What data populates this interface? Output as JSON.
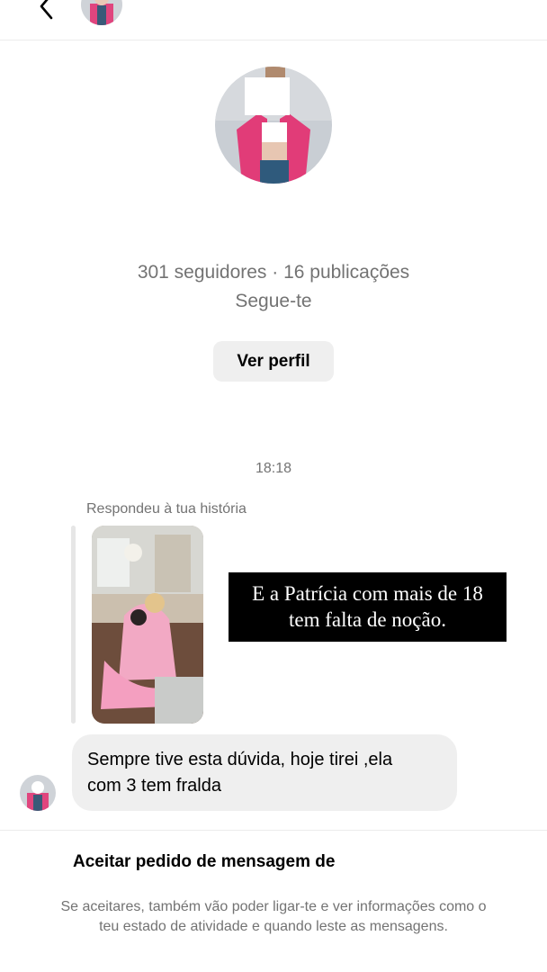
{
  "profile": {
    "stats": "301 seguidores · 16 publicações",
    "follow_status": "Segue-te",
    "view_profile_label": "Ver perfil"
  },
  "thread": {
    "timestamp": "18:18",
    "replied_label": "Respondeu à tua história",
    "story_caption": {
      "line1": "E a Patrícia com mais de 18",
      "line2": "tem falta de noção."
    },
    "message": {
      "line1": "Sempre tive esta dúvida, hoje tirei ,ela",
      "line2": "com 3 tem fralda"
    }
  },
  "request": {
    "title": "Aceitar pedido de mensagem de",
    "info_line1": "Se aceitares, também vão poder ligar-te e ver informações como o",
    "info_line2": "teu estado de atividade e quando leste as mensagens."
  },
  "icons": {
    "back": "chevron-left-icon"
  },
  "colors": {
    "secondary_text": "#737373",
    "bubble_bg": "#efefef",
    "caption_bg": "#000000"
  }
}
